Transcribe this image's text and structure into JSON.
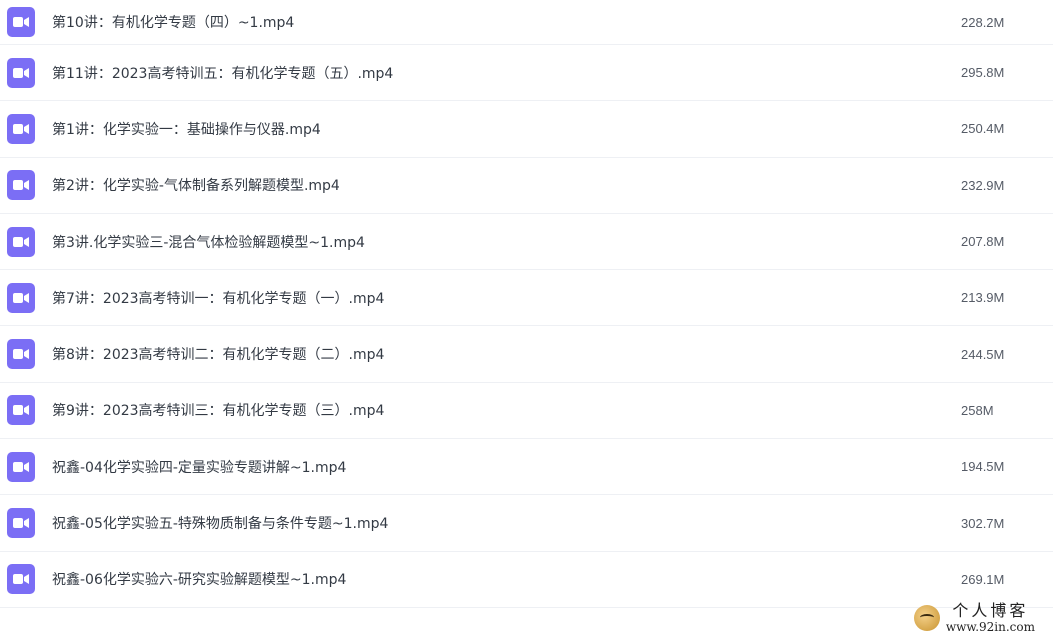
{
  "files": [
    {
      "name": "第10讲：有机化学专题（四）~1.mp4",
      "size": "228.2M",
      "icon": "video-file-icon"
    },
    {
      "name": "第11讲：2023高考特训五：有机化学专题（五）.mp4",
      "size": "295.8M",
      "icon": "video-file-icon"
    },
    {
      "name": "第1讲：化学实验一：基础操作与仪器.mp4",
      "size": "250.4M",
      "icon": "video-file-icon"
    },
    {
      "name": "第2讲：化学实验-气体制备系列解题模型.mp4",
      "size": "232.9M",
      "icon": "video-file-icon"
    },
    {
      "name": "第3讲.化学实验三-混合气体检验解题模型~1.mp4",
      "size": "207.8M",
      "icon": "video-file-icon"
    },
    {
      "name": "第7讲：2023高考特训一：有机化学专题（一）.mp4",
      "size": "213.9M",
      "icon": "video-file-icon"
    },
    {
      "name": "第8讲：2023高考特训二：有机化学专题（二）.mp4",
      "size": "244.5M",
      "icon": "video-file-icon"
    },
    {
      "name": "第9讲：2023高考特训三：有机化学专题（三）.mp4",
      "size": "258M",
      "icon": "video-file-icon"
    },
    {
      "name": "祝鑫-04化学实验四-定量实验专题讲解~1.mp4",
      "size": "194.5M",
      "icon": "video-file-icon"
    },
    {
      "name": "祝鑫-05化学实验五-特殊物质制备与条件专题~1.mp4",
      "size": "302.7M",
      "icon": "video-file-icon"
    },
    {
      "name": "祝鑫-06化学实验六-研究实验解题模型~1.mp4",
      "size": "269.1M",
      "icon": "video-file-icon"
    }
  ],
  "colors": {
    "icon_bg": "#7b6ef5",
    "row_divider": "#eef0f4",
    "text": "#333a44"
  },
  "watermark": {
    "title": "个人博客",
    "url": "www.92in.com"
  }
}
